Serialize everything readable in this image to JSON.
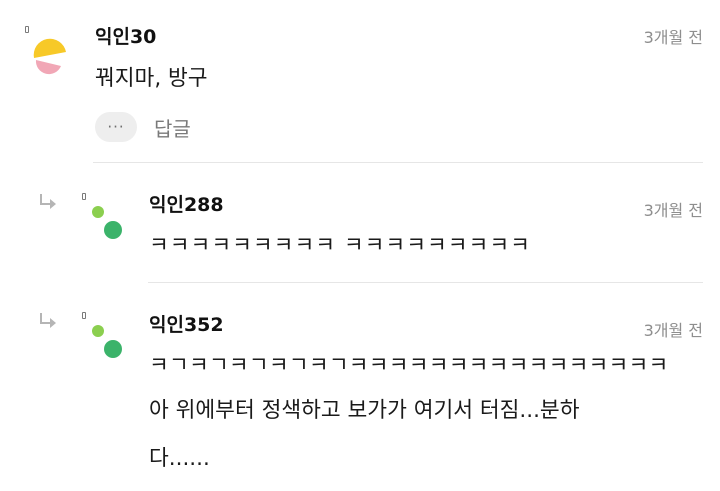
{
  "comments": [
    {
      "username": "익인30",
      "time": "3개월 전",
      "lines": [
        "꿔지마, 방구"
      ],
      "more_label": "···",
      "reply_label": "답글",
      "colors": {
        "avatar_primary": "#f7c928",
        "avatar_secondary": "#f1a7b6"
      }
    },
    {
      "username": "익인288",
      "time": "3개월 전",
      "lines": [
        "ㅋㅋㅋㅋㅋㅋㅋㅋㅋ ㅋㅋㅋㅋㅋㅋㅋㅋㅋ"
      ],
      "colors": {
        "avatar_small": "#8bcf4f",
        "avatar_large": "#3bb36a"
      }
    },
    {
      "username": "익인352",
      "time": "3개월 전",
      "lines": [
        "ㅋㄱㅋㄱㅋㄱㅋㄱㅋㄱㅋㅋㅋㅋㅋㅋㅋㅋㅋㅋㅋㅋㅋㅋㅋㅋ",
        "아 위에부터 정색하고 보가가 여기서 터짐...분하",
        "다......"
      ],
      "colors": {
        "avatar_small": "#8bcf4f",
        "avatar_large": "#3bb36a"
      }
    }
  ],
  "icons": {
    "reply_arrow": "reply-arrow-icon",
    "marker": "badge-marker-icon"
  }
}
